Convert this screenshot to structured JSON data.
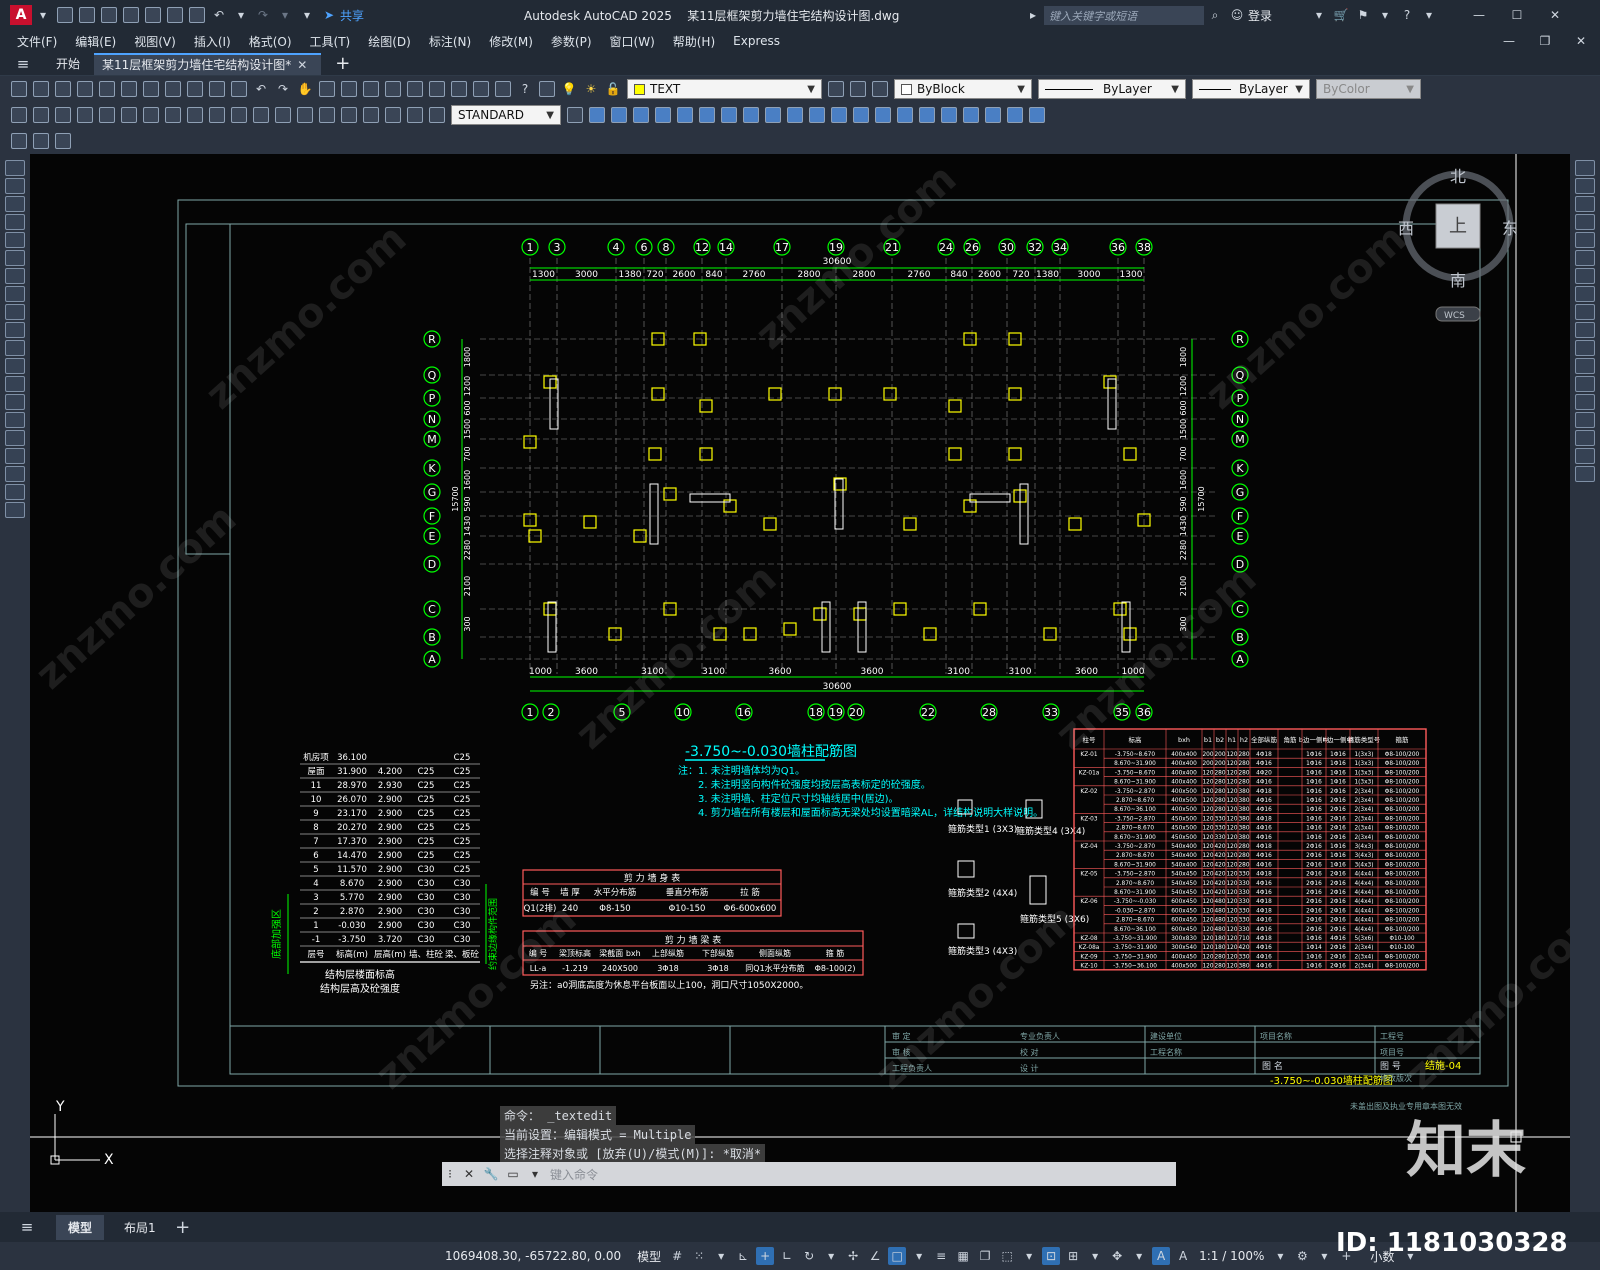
{
  "title": {
    "app_icon": "A",
    "share_label": "共享",
    "caption": "Autodesk AutoCAD 2025    某11层框架剪力墙住宅结构设计图.dwg",
    "search_placeholder": "键入关键字或短语",
    "login_label": "登录"
  },
  "menu": [
    "文件(F)",
    "编辑(E)",
    "视图(V)",
    "插入(I)",
    "格式(O)",
    "工具(T)",
    "绘图(D)",
    "标注(N)",
    "修改(M)",
    "参数(P)",
    "窗口(W)",
    "帮助(H)",
    "Express"
  ],
  "doc_tabs": {
    "start": "开始",
    "active": "某11层框架剪力墙住宅结构设计图*",
    "add": "+"
  },
  "toolbar": {
    "text_style": "TEXT",
    "dim_style": "STANDARD",
    "color": "ByBlock",
    "linetype": "ByLayer",
    "lineweight": "ByLayer",
    "plotstyle": "ByColor"
  },
  "viewcube": {
    "north": "北",
    "south": "南",
    "east": "东",
    "west": "西",
    "top": "上",
    "wcs": "WCS"
  },
  "drawing": {
    "grid_top": [
      "1",
      "3",
      "4",
      "6",
      "8",
      "12",
      "14",
      "17",
      "19",
      "21",
      "24",
      "26",
      "30",
      "32",
      "34",
      "36",
      "38"
    ],
    "dims_top": [
      "1300",
      "3000",
      "1380",
      "720",
      "2600",
      "840",
      "2760",
      "2800",
      "2800",
      "2760",
      "840",
      "2600",
      "720",
      "1380",
      "3000",
      "1300"
    ],
    "total_top": "30600",
    "grid_bottom": [
      "1",
      "2",
      "5",
      "10",
      "16",
      "18",
      "19",
      "20",
      "22",
      "28",
      "33",
      "35",
      "36"
    ],
    "dims_bottom": [
      "1000",
      "3600",
      "3100",
      "3100",
      "3600",
      "3600",
      "3100",
      "3100",
      "3600",
      "1000"
    ],
    "total_bottom": "30600",
    "grid_rows": [
      "R",
      "Q",
      "P",
      "N",
      "M",
      "K",
      "G",
      "F",
      "E",
      "D",
      "C",
      "B",
      "A"
    ],
    "dims_left": [
      "1800",
      "1200",
      "600",
      "1500",
      "700",
      "1600",
      "590",
      "1430",
      "2280",
      "2100",
      "300"
    ],
    "total_left": "15700",
    "plan_title": "-3.750~-0.030墙柱配筋图",
    "notes": [
      "注：1. 未注明墙体均为Q1。",
      "2. 未注明竖向构件砼强度均按层高表标定的砼强度。",
      "3. 未注明墙、柱定位尺寸均轴线居中(居边)。",
      "4. 剪力墙在所有楼层和屋面标高无梁处均设置暗梁AL，详结构说明大样说明。"
    ],
    "stirrup_types": [
      "箍筋类型1 (3X3)",
      "箍筋类型4 (3X4)",
      "箍筋类型2 (4X4)",
      "箍筋类型5 (3X6)",
      "箍筋类型3 (4X3)"
    ],
    "floor_table": {
      "rows": [
        [
          "机房项",
          "36.100",
          "",
          "",
          "C25"
        ],
        [
          "屋面",
          "31.900",
          "4.200",
          "C25",
          "C25"
        ],
        [
          "11",
          "28.970",
          "2.930",
          "C25",
          "C25"
        ],
        [
          "10",
          "26.070",
          "2.900",
          "C25",
          "C25"
        ],
        [
          "9",
          "23.170",
          "2.900",
          "C25",
          "C25"
        ],
        [
          "8",
          "20.270",
          "2.900",
          "C25",
          "C25"
        ],
        [
          "7",
          "17.370",
          "2.900",
          "C25",
          "C25"
        ],
        [
          "6",
          "14.470",
          "2.900",
          "C25",
          "C25"
        ],
        [
          "5",
          "11.570",
          "2.900",
          "C30",
          "C25"
        ],
        [
          "4",
          "8.670",
          "2.900",
          "C30",
          "C30"
        ],
        [
          "3",
          "5.770",
          "2.900",
          "C30",
          "C30"
        ],
        [
          "2",
          "2.870",
          "2.900",
          "C30",
          "C30"
        ],
        [
          "1",
          "-0.030",
          "2.900",
          "C30",
          "C30"
        ],
        [
          "-1",
          "-3.750",
          "3.720",
          "C30",
          "C30"
        ]
      ],
      "header": [
        "层号",
        "标高(m)",
        "层高(m)",
        "墙、柱砼",
        "梁、板砼"
      ],
      "side_left": "底部加强区",
      "side_right": "约束边缘构件范围",
      "caption1": "结构层楼面标高",
      "caption2": "结构层高及砼强度"
    },
    "shear_wall_table": {
      "title": "剪 力 墙 身 表",
      "header": [
        "编 号",
        "墙 厚",
        "水平分布筋",
        "垂直分布筋",
        "拉 筋"
      ],
      "rows": [
        [
          "Q1(2排)",
          "240",
          "Φ8-150",
          "Φ10-150",
          "Φ6-600x600"
        ]
      ]
    },
    "coupling_beam_table": {
      "title": "剪 力 墙 梁 表",
      "header": [
        "编 号",
        "梁顶标高",
        "梁截面 bxh",
        "上部纵筋",
        "下部纵筋",
        "侧面纵筋",
        "箍 筋"
      ],
      "rows": [
        [
          "LL-a",
          "-1.219",
          "240X500",
          "3Φ18",
          "3Φ18",
          "同Q1水平分布筋",
          "Φ8-100(2)"
        ]
      ],
      "note": "另注：a0洞底高度为休息平台板面以上100，洞口尺寸1050X2000。"
    },
    "column_table": {
      "header": [
        "柱号",
        "标高",
        "bxh",
        "b1",
        "b2",
        "h1",
        "h2",
        "全部纵筋",
        "角筋",
        "b边一侧中部筋",
        "h边一侧中部筋",
        "箍筋类型号",
        "箍筋"
      ],
      "rows": [
        [
          "KZ-01",
          "-3.750~8.670",
          "400x400",
          "200",
          "200",
          "120",
          "280",
          "4Φ18",
          "1Φ16",
          "1Φ16",
          "1(3x3)",
          "Φ8-100/200"
        ],
        [
          "",
          "8.670~31.900",
          "400x400",
          "200",
          "200",
          "120",
          "280",
          "4Φ16",
          "1Φ16",
          "1Φ16",
          "1(3x3)",
          "Φ8-100/200"
        ],
        [
          "KZ-01a",
          "-3.750~8.670",
          "400x400",
          "120",
          "280",
          "120",
          "280",
          "4Φ20",
          "1Φ16",
          "1Φ16",
          "1(3x3)",
          "Φ8-100/200"
        ],
        [
          "",
          "8.670~31.900",
          "400x400",
          "120",
          "280",
          "120",
          "280",
          "4Φ16",
          "1Φ16",
          "1Φ16",
          "1(3x3)",
          "Φ8-100/200"
        ],
        [
          "KZ-02",
          "-3.750~2.870",
          "400x500",
          "120",
          "280",
          "120",
          "380",
          "4Φ18",
          "1Φ16",
          "2Φ16",
          "2(3x4)",
          "Φ8-100/200"
        ],
        [
          "",
          "2.870~8.670",
          "400x500",
          "120",
          "280",
          "120",
          "380",
          "4Φ16",
          "1Φ16",
          "2Φ16",
          "2(3x4)",
          "Φ8-100/200"
        ],
        [
          "",
          "8.670~36.100",
          "400x500",
          "120",
          "280",
          "120",
          "380",
          "4Φ16",
          "1Φ16",
          "2Φ16",
          "2(3x4)",
          "Φ8-100/200"
        ],
        [
          "KZ-03",
          "-3.750~2.870",
          "450x500",
          "120",
          "330",
          "120",
          "380",
          "4Φ18",
          "1Φ16",
          "2Φ16",
          "2(3x4)",
          "Φ8-100/200"
        ],
        [
          "",
          "2.870~8.670",
          "450x500",
          "120",
          "330",
          "120",
          "380",
          "4Φ16",
          "1Φ16",
          "2Φ16",
          "2(3x4)",
          "Φ8-100/200"
        ],
        [
          "",
          "8.670~31.900",
          "450x500",
          "120",
          "330",
          "120",
          "380",
          "4Φ16",
          "1Φ16",
          "2Φ16",
          "2(3x4)",
          "Φ8-100/200"
        ],
        [
          "KZ-04",
          "-3.750~2.870",
          "540x400",
          "120",
          "420",
          "120",
          "280",
          "4Φ18",
          "2Φ16",
          "1Φ16",
          "3(4x3)",
          "Φ8-100/200"
        ],
        [
          "",
          "2.870~8.670",
          "540x400",
          "120",
          "420",
          "120",
          "280",
          "4Φ16",
          "2Φ16",
          "1Φ16",
          "3(4x3)",
          "Φ8-100/200"
        ],
        [
          "",
          "8.670~31.900",
          "540x400",
          "120",
          "420",
          "120",
          "280",
          "4Φ16",
          "2Φ16",
          "1Φ16",
          "3(4x3)",
          "Φ8-100/200"
        ],
        [
          "KZ-05",
          "-3.750~2.870",
          "540x450",
          "120",
          "420",
          "120",
          "330",
          "4Φ18",
          "2Φ16",
          "2Φ16",
          "4(4x4)",
          "Φ8-100/200"
        ],
        [
          "",
          "2.870~8.670",
          "540x450",
          "120",
          "420",
          "120",
          "330",
          "4Φ16",
          "2Φ16",
          "2Φ16",
          "4(4x4)",
          "Φ8-100/200"
        ],
        [
          "",
          "8.670~31.900",
          "540x450",
          "120",
          "420",
          "120",
          "330",
          "4Φ16",
          "2Φ16",
          "2Φ16",
          "4(4x4)",
          "Φ8-100/200"
        ],
        [
          "KZ-06",
          "-3.750~-0.030",
          "600x450",
          "120",
          "480",
          "120",
          "330",
          "4Φ18",
          "2Φ16",
          "2Φ16",
          "4(4x4)",
          "Φ8-100/200"
        ],
        [
          "",
          "-0.030~2.870",
          "600x450",
          "120",
          "480",
          "120",
          "330",
          "4Φ18",
          "2Φ16",
          "2Φ16",
          "4(4x4)",
          "Φ8-100/200"
        ],
        [
          "",
          "2.870~8.670",
          "600x450",
          "120",
          "480",
          "120",
          "330",
          "4Φ16",
          "2Φ16",
          "2Φ16",
          "4(4x4)",
          "Φ8-100/200"
        ],
        [
          "",
          "8.670~36.100",
          "600x450",
          "120",
          "480",
          "120",
          "330",
          "4Φ16",
          "2Φ16",
          "2Φ16",
          "4(4x4)",
          "Φ8-100/200"
        ],
        [
          "KZ-08",
          "-3.750~31.900",
          "300x830",
          "120",
          "180",
          "120",
          "710",
          "4Φ18",
          "1Φ16",
          "4Φ16",
          "5(3x6)",
          "Φ10-100"
        ],
        [
          "KZ-08a",
          "-3.750~31.900",
          "300x540",
          "120",
          "180",
          "120",
          "420",
          "4Φ16",
          "1Φ14",
          "2Φ16",
          "2(3x4)",
          "Φ10-100"
        ],
        [
          "KZ-09",
          "-3.750~31.900",
          "400x450",
          "120",
          "280",
          "120",
          "330",
          "4Φ16",
          "1Φ16",
          "2Φ16",
          "2(3x4)",
          "Φ8-100/200"
        ],
        [
          "KZ-10",
          "-3.750~36.100",
          "400x500",
          "120",
          "280",
          "120",
          "380",
          "4Φ16",
          "1Φ16",
          "2Φ16",
          "2(3x4)",
          "Φ8-100/200"
        ]
      ]
    },
    "title_block": {
      "drawing_name_label": "图 名",
      "drawing_name": "-3.750~-0.030墙柱配筋图",
      "sheet_label": "图 号",
      "sheet": "结施-04",
      "fields": [
        "审 定",
        "审 核",
        "专业负责人",
        "校 对",
        "工程负责人",
        "设 计",
        "建设单位",
        "工程名称",
        "项目名称",
        "工程号",
        "项目号",
        "修改版次"
      ],
      "stamp_note": "未盖出图及执业专用章本图无效"
    },
    "ucs": {
      "x": "X",
      "y": "Y"
    }
  },
  "command": {
    "history": [
      "命令： _textedit",
      "当前设置：编辑模式 = Multiple",
      "选择注释对象或 [放弃(U)/模式(M)]: *取消*"
    ],
    "prompt_placeholder": "键入命令"
  },
  "layouts": {
    "model": "模型",
    "layout1": "布局1"
  },
  "status": {
    "coords": "1069408.30, -65722.80, 0.00",
    "model": "模型",
    "scale": "1:1 / 100%",
    "units": "小数"
  },
  "watermark": {
    "brand": "知末",
    "id": "ID: 1181030328",
    "tile": "znzmo.com"
  }
}
